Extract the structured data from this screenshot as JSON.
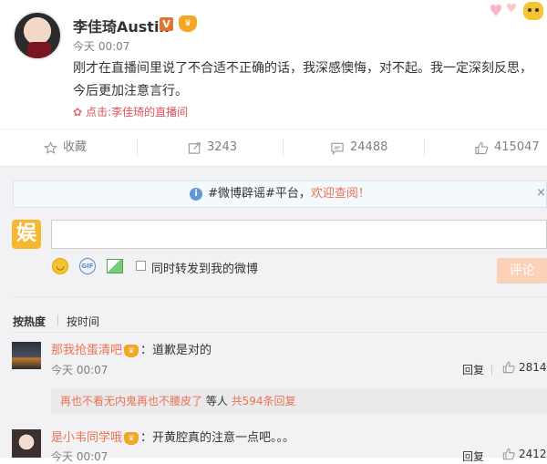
{
  "post": {
    "username": "李佳琦Austin",
    "verified_badge": "V",
    "member_badge": "会员",
    "timestamp": "今天 00:07",
    "content": "刚才在直播间里说了不合适不正确的话，我深感懊悔，对不起。我一定深刻反思，今后更加注意言行。",
    "source": "点击:李佳琦的直播间"
  },
  "actions": {
    "favorite": "收藏",
    "forward": "3243",
    "comment": "24488",
    "like": "415047"
  },
  "notice": {
    "text_prefix": "#微博辟谣#平台，",
    "link_text": "欢迎查阅！",
    "close": "×"
  },
  "composer": {
    "avatar_char": "娱",
    "input_value": "",
    "forward_checkbox_label": "同时转发到我的微博",
    "submit_label": "评论"
  },
  "sort": {
    "hot": "按热度",
    "time": "按时间"
  },
  "comments": [
    {
      "username": "那我抢蛋清吧",
      "text": "：道歉是对的",
      "timestamp": "今天 00:07",
      "reply_label": "回复",
      "likes": "2814",
      "subreply": {
        "text": "再也不看无内鬼再也不腰皮了",
        "suffix": " 等人 ",
        "count_link": "共594条回复"
      }
    },
    {
      "username": "是小韦同学哦",
      "text": "：开黄腔真的注意一点吧。。。",
      "timestamp": "今天 00:07",
      "reply_label": "回复",
      "likes": "2412"
    }
  ],
  "colors": {
    "accent": "#eb7350",
    "notice_bg": "#f4f9fd",
    "page_bg": "#f2f2f5",
    "submit_bg": "#fbd1b8"
  },
  "icons": [
    "star-icon",
    "forward-icon",
    "comment-icon",
    "thumbs-up-icon",
    "info-icon",
    "smiley-icon",
    "gif-icon",
    "picture-icon",
    "heart-deco-icon"
  ]
}
